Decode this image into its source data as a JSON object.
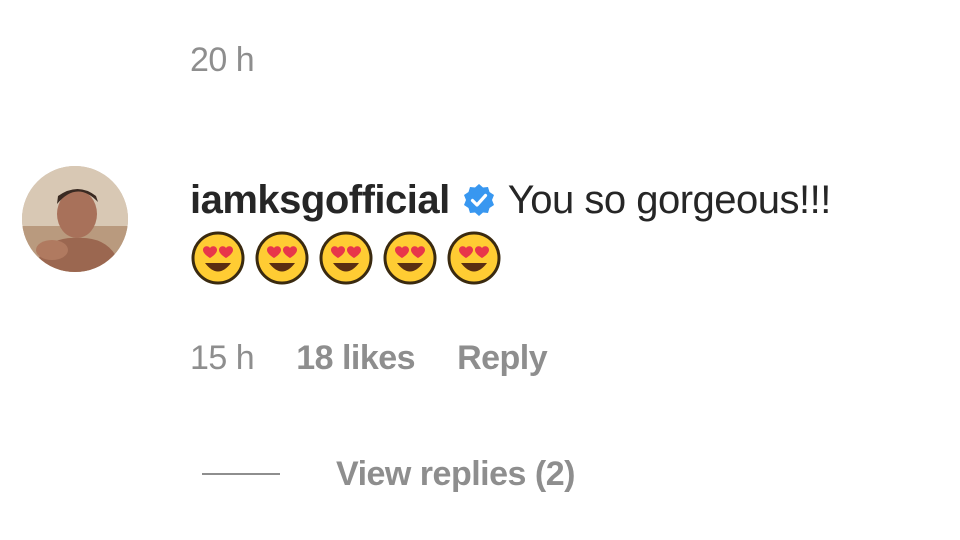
{
  "previous_comment": {
    "time": "20 h"
  },
  "comment": {
    "username": "iamksgofficial",
    "verified": true,
    "text": "You so gorgeous!!!",
    "emojis": [
      "heart-eyes-emoji",
      "heart-eyes-emoji",
      "heart-eyes-emoji",
      "heart-eyes-emoji",
      "heart-eyes-emoji"
    ],
    "time": "15 h",
    "likes": "18 likes",
    "reply_label": "Reply"
  },
  "replies": {
    "label": "View replies (2)"
  },
  "colors": {
    "text_primary": "#262626",
    "text_secondary": "#8e8e8e",
    "verified_blue": "#3897f0",
    "emoji_face": "#ffcc33",
    "emoji_heart": "#e8364a"
  }
}
